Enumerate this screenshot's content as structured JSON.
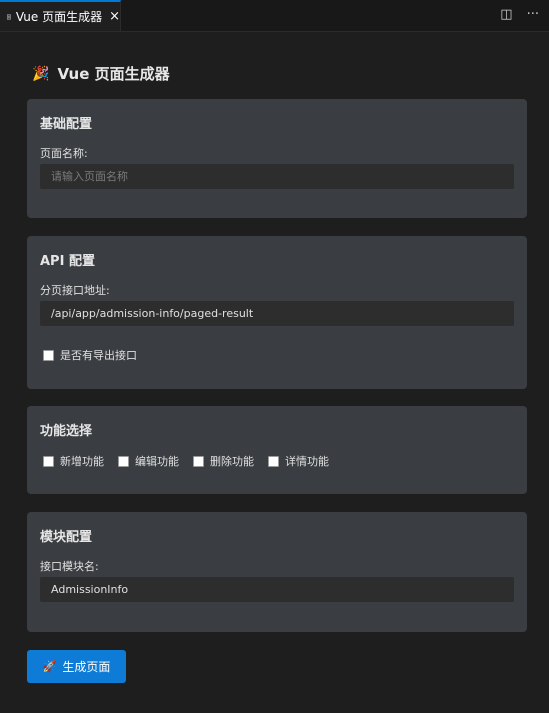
{
  "tab": {
    "title": "Vue 页面生成器",
    "icon": "preview-icon",
    "close": "×",
    "actions": [
      {
        "icon": "split-editor-icon",
        "glyph": "◫"
      },
      {
        "icon": "more-actions-icon",
        "glyph": "···"
      }
    ]
  },
  "page": {
    "title_emoji": "🎉",
    "title": "Vue 页面生成器"
  },
  "basic": {
    "title": "基础配置",
    "page_name_label": "页面名称:",
    "page_name_value": "",
    "page_name_placeholder": "请输入页面名称"
  },
  "api": {
    "title": "API 配置",
    "paged_url_label": "分页接口地址:",
    "paged_url_value": "/api/app/admission-info/paged-result",
    "export_label": "是否有导出接口",
    "export_checked": false
  },
  "features": {
    "title": "功能选择",
    "options": [
      {
        "label": "新增功能",
        "checked": false
      },
      {
        "label": "编辑功能",
        "checked": false
      },
      {
        "label": "删除功能",
        "checked": false
      },
      {
        "label": "详情功能",
        "checked": false
      }
    ]
  },
  "module": {
    "title": "模块配置",
    "module_name_label": "接口模块名:",
    "module_name_value": "AdmissionInfo"
  },
  "generate_button": {
    "emoji": "🚀",
    "label": "生成页面"
  },
  "colors": {
    "accent": "#0e7bd6",
    "panel": "#3a3d41",
    "background": "#1e1e1e"
  }
}
